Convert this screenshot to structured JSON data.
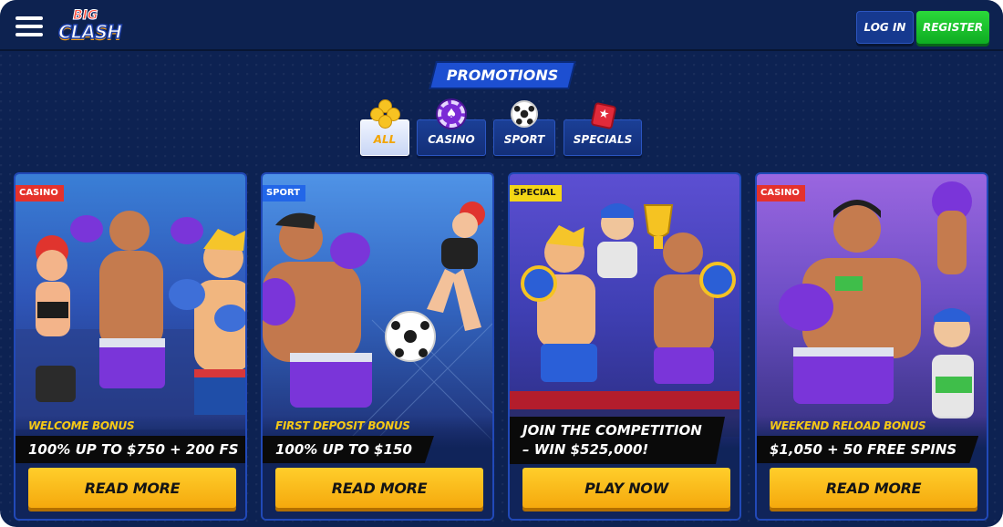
{
  "header": {
    "logo_top": "BIG",
    "logo_bottom": "CLASH",
    "login_label": "LOG IN",
    "register_label": "REGISTER"
  },
  "promotions_title": "PROMOTIONS",
  "tabs": [
    {
      "label": "ALL",
      "icon": "clover-icon",
      "active": true
    },
    {
      "label": "CASINO",
      "icon": "poker-chip-icon",
      "active": false
    },
    {
      "label": "SPORT",
      "icon": "soccer-ball-icon",
      "active": false
    },
    {
      "label": "SPECIALS",
      "icon": "gift-bag-icon",
      "active": false
    }
  ],
  "cards": [
    {
      "badge": "CASINO",
      "label": "WELCOME BONUS",
      "offer": "100% UP TO $750 + 200 FS",
      "cta": "READ MORE",
      "art": "boxers-group-illustration"
    },
    {
      "badge": "SPORT",
      "label": "FIRST DEPOSIT BONUS",
      "offer": "100% UP TO $150",
      "cta": "READ MORE",
      "art": "fighter-kicking-ball-illustration"
    },
    {
      "badge": "SPECIAL",
      "label": "",
      "offer": "JOIN THE COMPETITION – WIN $525,000!",
      "cta": "PLAY NOW",
      "art": "champions-with-trophy-illustration"
    },
    {
      "badge": "CASINO",
      "label": "WEEKEND RELOAD BONUS",
      "offer": "$1,050 + 50 FREE SPINS",
      "cta": "READ MORE",
      "art": "boxer-with-cash-illustration"
    }
  ],
  "colors": {
    "background": "#0d2252",
    "accent_yellow": "#f5c816",
    "register_green": "#16c22c",
    "badge_casino": "#e5322c",
    "badge_sport": "#2266e8",
    "badge_special": "#f4d616"
  }
}
